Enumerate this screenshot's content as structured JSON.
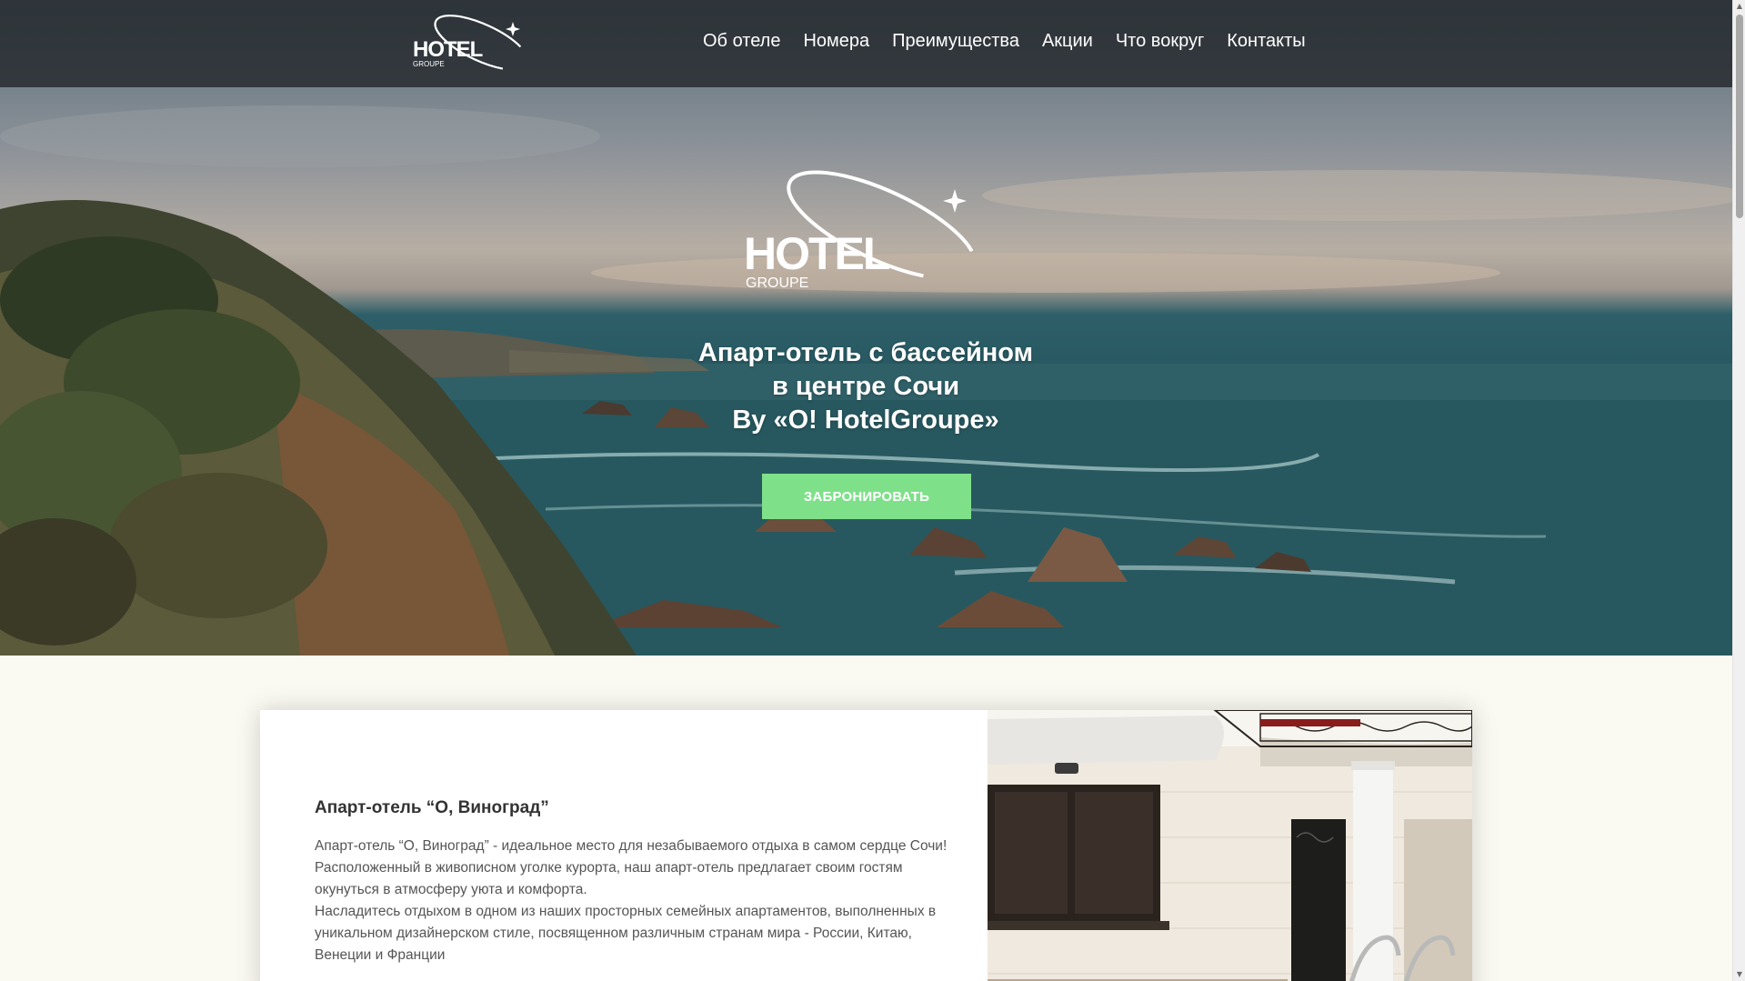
{
  "header": {
    "logo": {
      "text": "HOTEL",
      "subtext": "GROUPE",
      "icon": "hotel-groupe-logo"
    },
    "nav": [
      {
        "label": "Об отеле"
      },
      {
        "label": "Номера"
      },
      {
        "label": "Преимущества"
      },
      {
        "label": "Акции"
      },
      {
        "label": "Что вокруг"
      },
      {
        "label": "Контакты"
      }
    ]
  },
  "hero": {
    "logo": {
      "text": "HOTEL",
      "subtext": "GROUPE"
    },
    "title_line1": "Апарт-отель с бассейном",
    "title_line2": "в центре Сочи",
    "title_line3": "By «O! HotelGroupe»",
    "book_button": "ЗАБРОНИРОВАТЬ",
    "image": "coastline-cliffs-sea-photo"
  },
  "about": {
    "title": "Апарт-отель “О, Виноград”",
    "paragraph1": "Апарт-отель “О, Виноград” - идеальное место для незабываемого отдыха в самом сердце Сочи! Расположенный в живописном уголке курорта, наш апарт-отель предлагает своим гостям окунуться в атмосферу уюта и комфорта.",
    "paragraph2": "Насладитесь отдыхом в одном из наших просторных семейных апартаментов, выполненных в уникальном дизайнерском стиле, посвященном различным странам мира - России, Китаю, Венеции и Франции",
    "image": "hotel-facade-photo"
  },
  "colors": {
    "accent": "#7fe08a",
    "nav_bg": "#23282c",
    "page_bg": "#fbfaf2"
  }
}
